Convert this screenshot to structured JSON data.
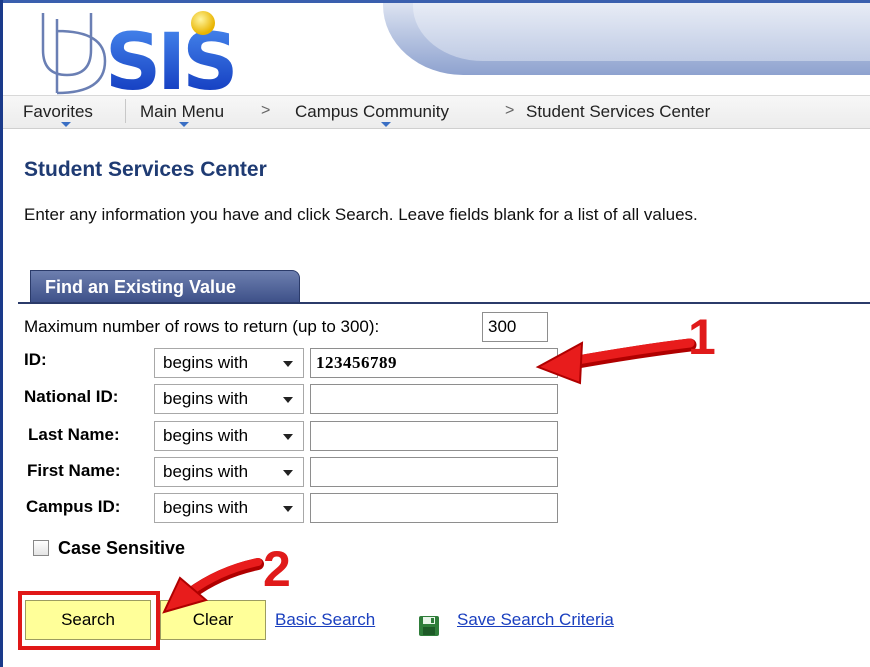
{
  "logo": {
    "text": "UDSIS"
  },
  "nav": {
    "favorites": "Favorites",
    "main_menu": "Main Menu",
    "campus_community": "Campus Community",
    "student_services_center": "Student Services Center",
    "separator": ">"
  },
  "page": {
    "title": "Student Services Center",
    "instructions": "Enter any information you have and click Search. Leave fields blank for a list of all values."
  },
  "tab": {
    "label": "Find an Existing Value"
  },
  "form": {
    "max_rows_label": "Maximum number of rows to return (up to 300):",
    "max_rows_value": "300",
    "fields": [
      {
        "label": "ID:",
        "operator": "begins with",
        "value": "123456789"
      },
      {
        "label": "National ID:",
        "operator": "begins with",
        "value": ""
      },
      {
        "label": "Last Name:",
        "operator": "begins with",
        "value": ""
      },
      {
        "label": "First Name:",
        "operator": "begins with",
        "value": ""
      },
      {
        "label": "Campus ID:",
        "operator": "begins with",
        "value": ""
      }
    ],
    "case_sensitive_label": "Case Sensitive",
    "case_sensitive_checked": false
  },
  "actions": {
    "search": "Search",
    "clear": "Clear",
    "basic_search": "Basic Search",
    "save_criteria": "Save Search Criteria"
  },
  "annotations": {
    "one": "1",
    "two": "2"
  },
  "colors": {
    "title": "#1f3b73",
    "tab": "#3e5189",
    "button": "#ffff99",
    "highlight": "#e01818",
    "link": "#1a3fbf"
  },
  "icons": [
    "save-disk-icon",
    "red-arrow-icon"
  ]
}
